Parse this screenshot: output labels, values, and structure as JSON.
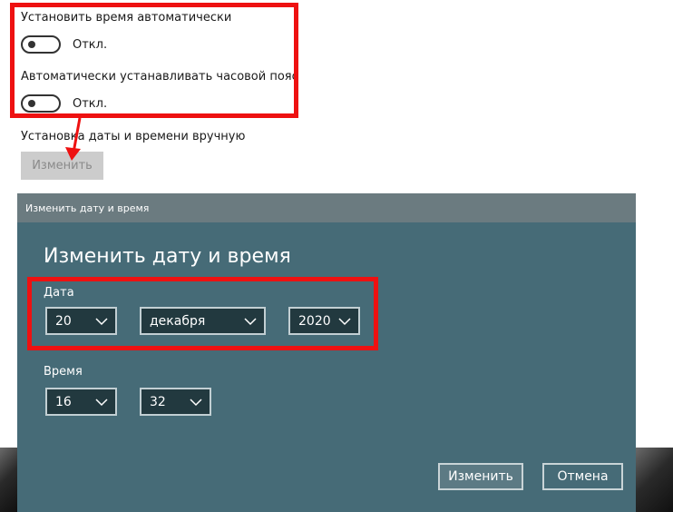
{
  "settings": {
    "auto_time_label": "Установить время автоматически",
    "auto_time_state": "Откл.",
    "auto_timezone_label": "Автоматически устанавливать часовой пояс",
    "auto_timezone_state": "Откл.",
    "manual_label": "Установка даты и времени вручную",
    "change_button": "Изменить"
  },
  "dialog": {
    "window_title": "Изменить дату и время",
    "heading": "Изменить дату и время",
    "date_label": "Дата",
    "day": "20",
    "month": "декабря",
    "year": "2020",
    "time_label": "Время",
    "hour": "16",
    "minute": "32",
    "confirm_button": "Изменить",
    "cancel_button": "Отмена"
  },
  "colors": {
    "annotation_red": "#ee1111",
    "dialog_bg": "#466b77",
    "dialog_titlebar": "#6b7b80",
    "dropdown_bg": "#22393f"
  }
}
